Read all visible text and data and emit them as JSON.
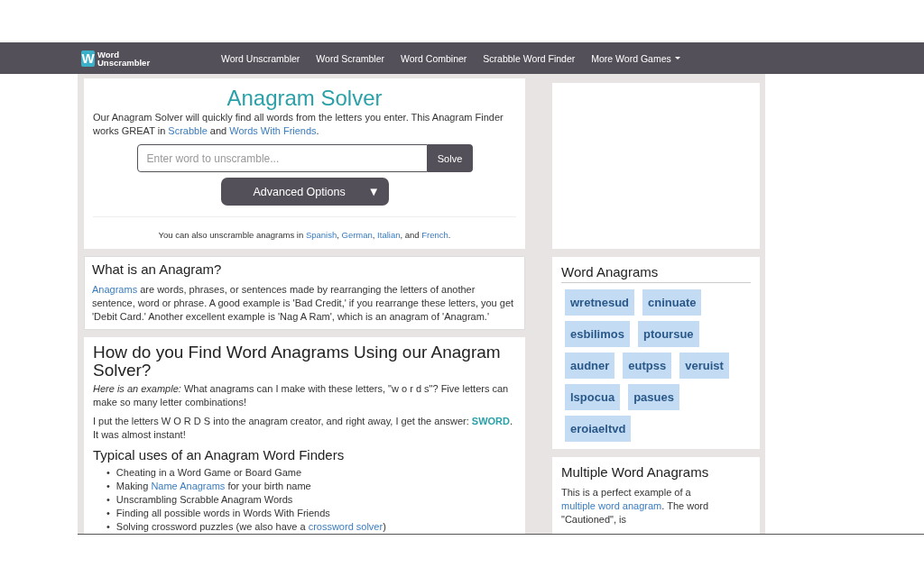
{
  "nav": {
    "logo": {
      "mark": "W",
      "line1": "Word",
      "line2": "Unscrambler"
    },
    "links": [
      {
        "label": "Word Unscrambler",
        "dropdown": false
      },
      {
        "label": "Word Scrambler",
        "dropdown": false
      },
      {
        "label": "Word Combiner",
        "dropdown": false
      },
      {
        "label": "Scrabble Word Finder",
        "dropdown": false
      },
      {
        "label": "More Word Games",
        "dropdown": true
      }
    ]
  },
  "solver": {
    "title": "Anagram Solver",
    "intro": [
      {
        "kind": "text",
        "text": "Our Anagram Solver will quickly find all words from the letters you enter. This Anagram Finder works GREAT in "
      },
      {
        "kind": "link",
        "text": "Scrabble"
      },
      {
        "kind": "text",
        "text": " and "
      },
      {
        "kind": "link",
        "text": "Words With Friends"
      },
      {
        "kind": "text",
        "text": "."
      }
    ],
    "search": {
      "placeholder": "Enter word to unscramble..."
    },
    "solve_button": "Solve",
    "advanced_button": "Advanced Options",
    "advanced_caret": "▼",
    "languages": [
      {
        "kind": "text",
        "text": "You can also unscramble anagrams in "
      },
      {
        "kind": "link",
        "text": "Spanish"
      },
      {
        "kind": "text",
        "text": ", "
      },
      {
        "kind": "link",
        "text": "German"
      },
      {
        "kind": "text",
        "text": ", "
      },
      {
        "kind": "link",
        "text": "Italian"
      },
      {
        "kind": "text",
        "text": ", and "
      },
      {
        "kind": "link",
        "text": "French"
      },
      {
        "kind": "text",
        "text": "."
      }
    ]
  },
  "what_is": {
    "heading": "What is an Anagram?",
    "body": [
      {
        "kind": "link",
        "text": "Anagrams"
      },
      {
        "kind": "text",
        "text": " are words, phrases, or sentences made by rearranging the letters of another sentence, word or phrase. A good example is 'Bad Credit,' if you rearrange these letters, you get 'Debit Card.' Another excellent example is 'Nag A Ram', which is an anagram of 'Anagram.'"
      }
    ]
  },
  "how_to": {
    "heading": "How do you Find Word Anagrams Using our Anagram Solver?",
    "paragraphs": [
      [
        {
          "kind": "italic",
          "text": "Here is an example:"
        },
        {
          "kind": "text",
          "text": " What anagrams can I make with these letters, \"w o r d s\"? Five letters can make so many letter combinations!"
        }
      ],
      [
        {
          "kind": "text",
          "text": "I put the letters W O R D S into the anagram creator, and right away, I get the answer: "
        },
        {
          "kind": "bold",
          "text": "SWORD"
        },
        {
          "kind": "text",
          "text": ". It was almost instant!"
        }
      ]
    ],
    "subheading": "Typical uses of an Anagram Word Finders",
    "uses": [
      {
        "bullet": "•",
        "parts": [
          {
            "kind": "text",
            "text": "Cheating in a Word Game or Board Game"
          }
        ]
      },
      {
        "bullet": "•",
        "parts": [
          {
            "kind": "text",
            "text": "Making "
          },
          {
            "kind": "link",
            "text": "Name Anagrams"
          },
          {
            "kind": "text",
            "text": " for your birth name"
          }
        ]
      },
      {
        "bullet": "•",
        "parts": [
          {
            "kind": "text",
            "text": "Unscrambling Scrabble Anagram Words"
          }
        ]
      },
      {
        "bullet": "•",
        "parts": [
          {
            "kind": "text",
            "text": "Finding all possible words in Words With Friends"
          }
        ]
      },
      {
        "bullet": "•",
        "parts": [
          {
            "kind": "text",
            "text": "Solving crossword puzzles (we also have a "
          },
          {
            "kind": "link",
            "text": "crossword solver"
          },
          {
            "kind": "text",
            "text": ")"
          }
        ]
      }
    ]
  },
  "word_anagrams": {
    "heading": "Word Anagrams",
    "tags": [
      "wretnesud",
      "cninuate",
      "esbilimos",
      "ptoursue",
      "audner",
      "eutpss",
      "veruist",
      "lspocua",
      "pasues",
      "eroiaeltvd"
    ]
  },
  "multiple": {
    "heading": "Multiple Word Anagrams",
    "body": [
      {
        "kind": "text",
        "text": "This is a perfect example of a "
      },
      {
        "kind": "link",
        "text": "multiple word anagram"
      },
      {
        "kind": "text",
        "text": ". The word \"Cautioned\", is"
      }
    ]
  }
}
